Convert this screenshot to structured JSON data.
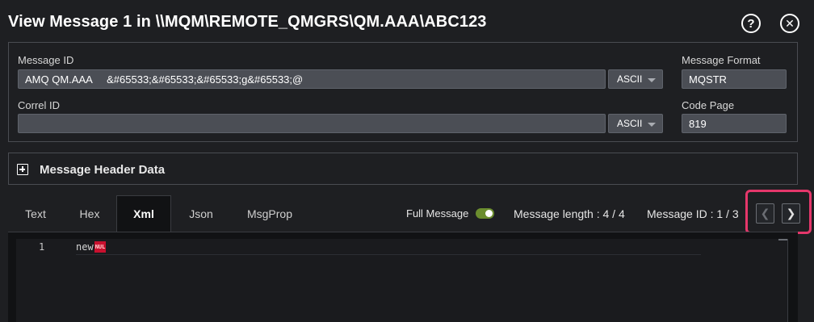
{
  "dialog": {
    "title": "View Message 1 in \\\\MQM\\REMOTE_QMGRS\\QM.AAA\\ABC123",
    "help_icon": "help-icon",
    "close_icon": "close-icon"
  },
  "fields": {
    "message_id_label": "Message ID",
    "message_id_value": "AMQ QM.AAA     &#65533;&#65533;&#65533;g&#65533;@",
    "message_id_encoding": "ASCII",
    "correl_id_label": "Correl ID",
    "correl_id_value": "",
    "correl_id_encoding": "ASCII",
    "message_format_label": "Message Format",
    "message_format_value": "MQSTR",
    "code_page_label": "Code Page",
    "code_page_value": "819"
  },
  "header_data": {
    "label": "Message Header Data",
    "icon": "expand-plus-icon"
  },
  "tabs": [
    {
      "label": "Text",
      "active": false
    },
    {
      "label": "Hex",
      "active": false
    },
    {
      "label": "Xml",
      "active": true
    },
    {
      "label": "Json",
      "active": false
    },
    {
      "label": "MsgProp",
      "active": false
    }
  ],
  "toolbar": {
    "full_message_label": "Full Message",
    "full_message_on": true,
    "message_length": "Message length : 4 / 4",
    "message_id_position": "Message ID : 1 / 3",
    "prev_icon": "chevron-left-icon",
    "next_icon": "chevron-right-icon"
  },
  "editor": {
    "lines": [
      {
        "number": "1",
        "text": "new",
        "control_char": "NUL"
      }
    ]
  },
  "colors": {
    "background": "#1e1f22",
    "input": "#4b4e55",
    "toggle_on": "#6b8d2e",
    "highlight": "#e5376b",
    "nul_badge": "#c8102e"
  }
}
